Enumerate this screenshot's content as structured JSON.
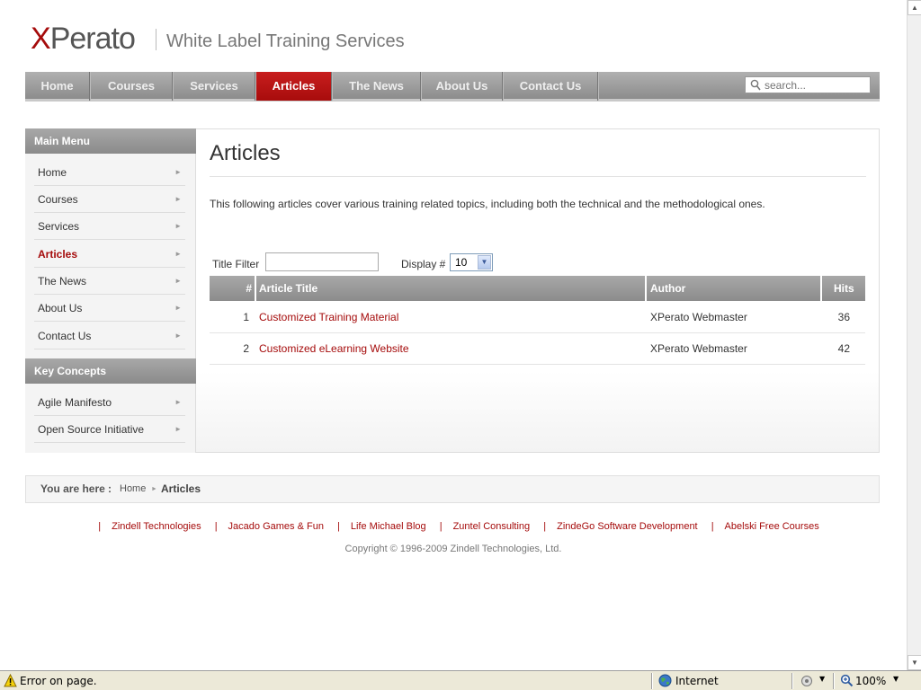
{
  "header": {
    "logo_x": "X",
    "logo_rest": "Perato",
    "tagline": "White Label Training Services"
  },
  "nav": {
    "items": [
      "Home",
      "Courses",
      "Services",
      "Articles",
      "The News",
      "About Us",
      "Contact Us"
    ],
    "active": "Articles",
    "search_placeholder": "search..."
  },
  "sidebar": {
    "main_menu_title": "Main Menu",
    "main_menu": [
      "Home",
      "Courses",
      "Services",
      "Articles",
      "The News",
      "About Us",
      "Contact Us"
    ],
    "key_concepts_title": "Key Concepts",
    "key_concepts": [
      "Agile Manifesto",
      "Open Source Initiative"
    ]
  },
  "content": {
    "title": "Articles",
    "intro": "This following articles cover various training related topics, including both the technical and the methodological ones.",
    "filter_label": "Title Filter",
    "filter_value": "",
    "display_label": "Display #",
    "display_value": "10",
    "columns": [
      "#",
      "Article Title",
      "Author",
      "Hits"
    ],
    "rows": [
      {
        "num": "1",
        "title": "Customized Training Material",
        "author": "XPerato Webmaster",
        "hits": "36"
      },
      {
        "num": "2",
        "title": "Customized eLearning Website",
        "author": "XPerato Webmaster",
        "hits": "42"
      }
    ]
  },
  "breadcrumb": {
    "label": "You are here",
    "separator": ":",
    "home": "Home",
    "current": "Articles"
  },
  "footer": {
    "links": [
      "Zindell Technologies",
      "Jacado Games & Fun",
      "Life Michael Blog",
      "Zuntel Consulting",
      "ZindeGo Software Development",
      "Abelski Free Courses"
    ],
    "copyright": "Copyright © 1996-2009 Zindell Technologies, Ltd."
  },
  "statusbar": {
    "message": "Error on page.",
    "zone": "Internet",
    "zoom": "100%"
  },
  "colors": {
    "brand_red": "#a50b0b",
    "nav_gray": "#8c8c8c"
  }
}
